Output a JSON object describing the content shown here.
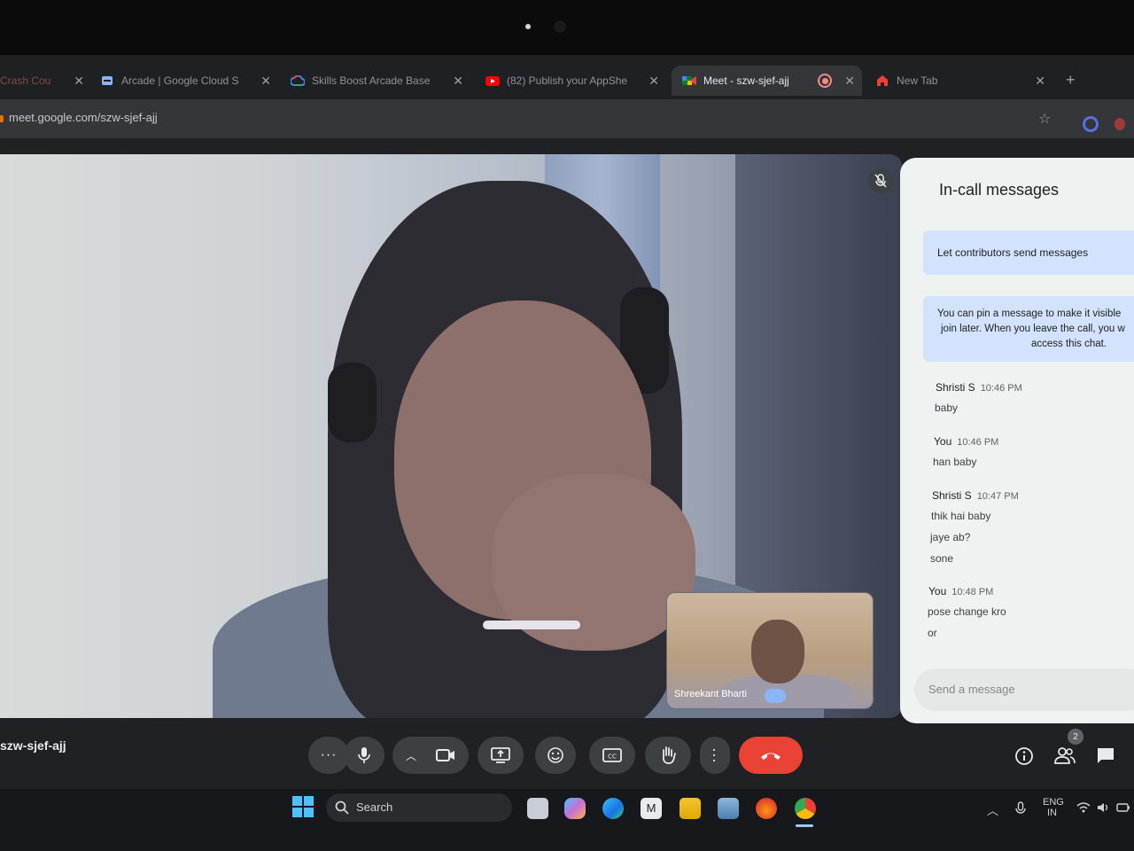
{
  "browser": {
    "tabs": [
      {
        "title": "Crash Cou",
        "favicon": "page-icon",
        "active": false
      },
      {
        "title": "Arcade | Google Cloud S",
        "favicon": "arcade-icon",
        "active": false
      },
      {
        "title": "Skills Boost Arcade Base",
        "favicon": "google-cloud-icon",
        "active": false
      },
      {
        "title": "(82) Publish your AppShe",
        "favicon": "youtube-icon",
        "active": false
      },
      {
        "title": "Meet - szw-sjef-ajj",
        "favicon": "meet-icon",
        "active": true
      },
      {
        "title": "New Tab",
        "favicon": "home-icon",
        "active": false
      }
    ],
    "url": "meet.google.com/szw-sjef-ajj"
  },
  "meeting": {
    "code": "szw-sjef-ajj",
    "self_tile_name": "Shreekant Bharti",
    "participant_count": "2"
  },
  "chat": {
    "title": "In-call messages",
    "toggle_label": "Let contributors send messages",
    "info_lines": [
      "You can pin a message to make it visible",
      "join later. When you leave the call, you w",
      "access this chat."
    ],
    "messages": [
      {
        "sender": "Shristi S",
        "time": "10:46 PM",
        "lines": [
          "baby"
        ]
      },
      {
        "sender": "You",
        "time": "10:46 PM",
        "lines": [
          "han baby"
        ]
      },
      {
        "sender": "Shristi S",
        "time": "10:47 PM",
        "lines": [
          "thik hai baby",
          "jaye ab?",
          "sone"
        ]
      },
      {
        "sender": "You",
        "time": "10:48 PM",
        "lines": [
          "pose change kro",
          "or"
        ]
      }
    ],
    "input_placeholder": "Send a message"
  },
  "taskbar": {
    "search_label": "Search",
    "lang_line1": "ENG",
    "lang_line2": "IN"
  },
  "colors": {
    "end_call": "#ea4335",
    "chat_highlight": "#d3e3fd",
    "meet_background": "#202124"
  }
}
